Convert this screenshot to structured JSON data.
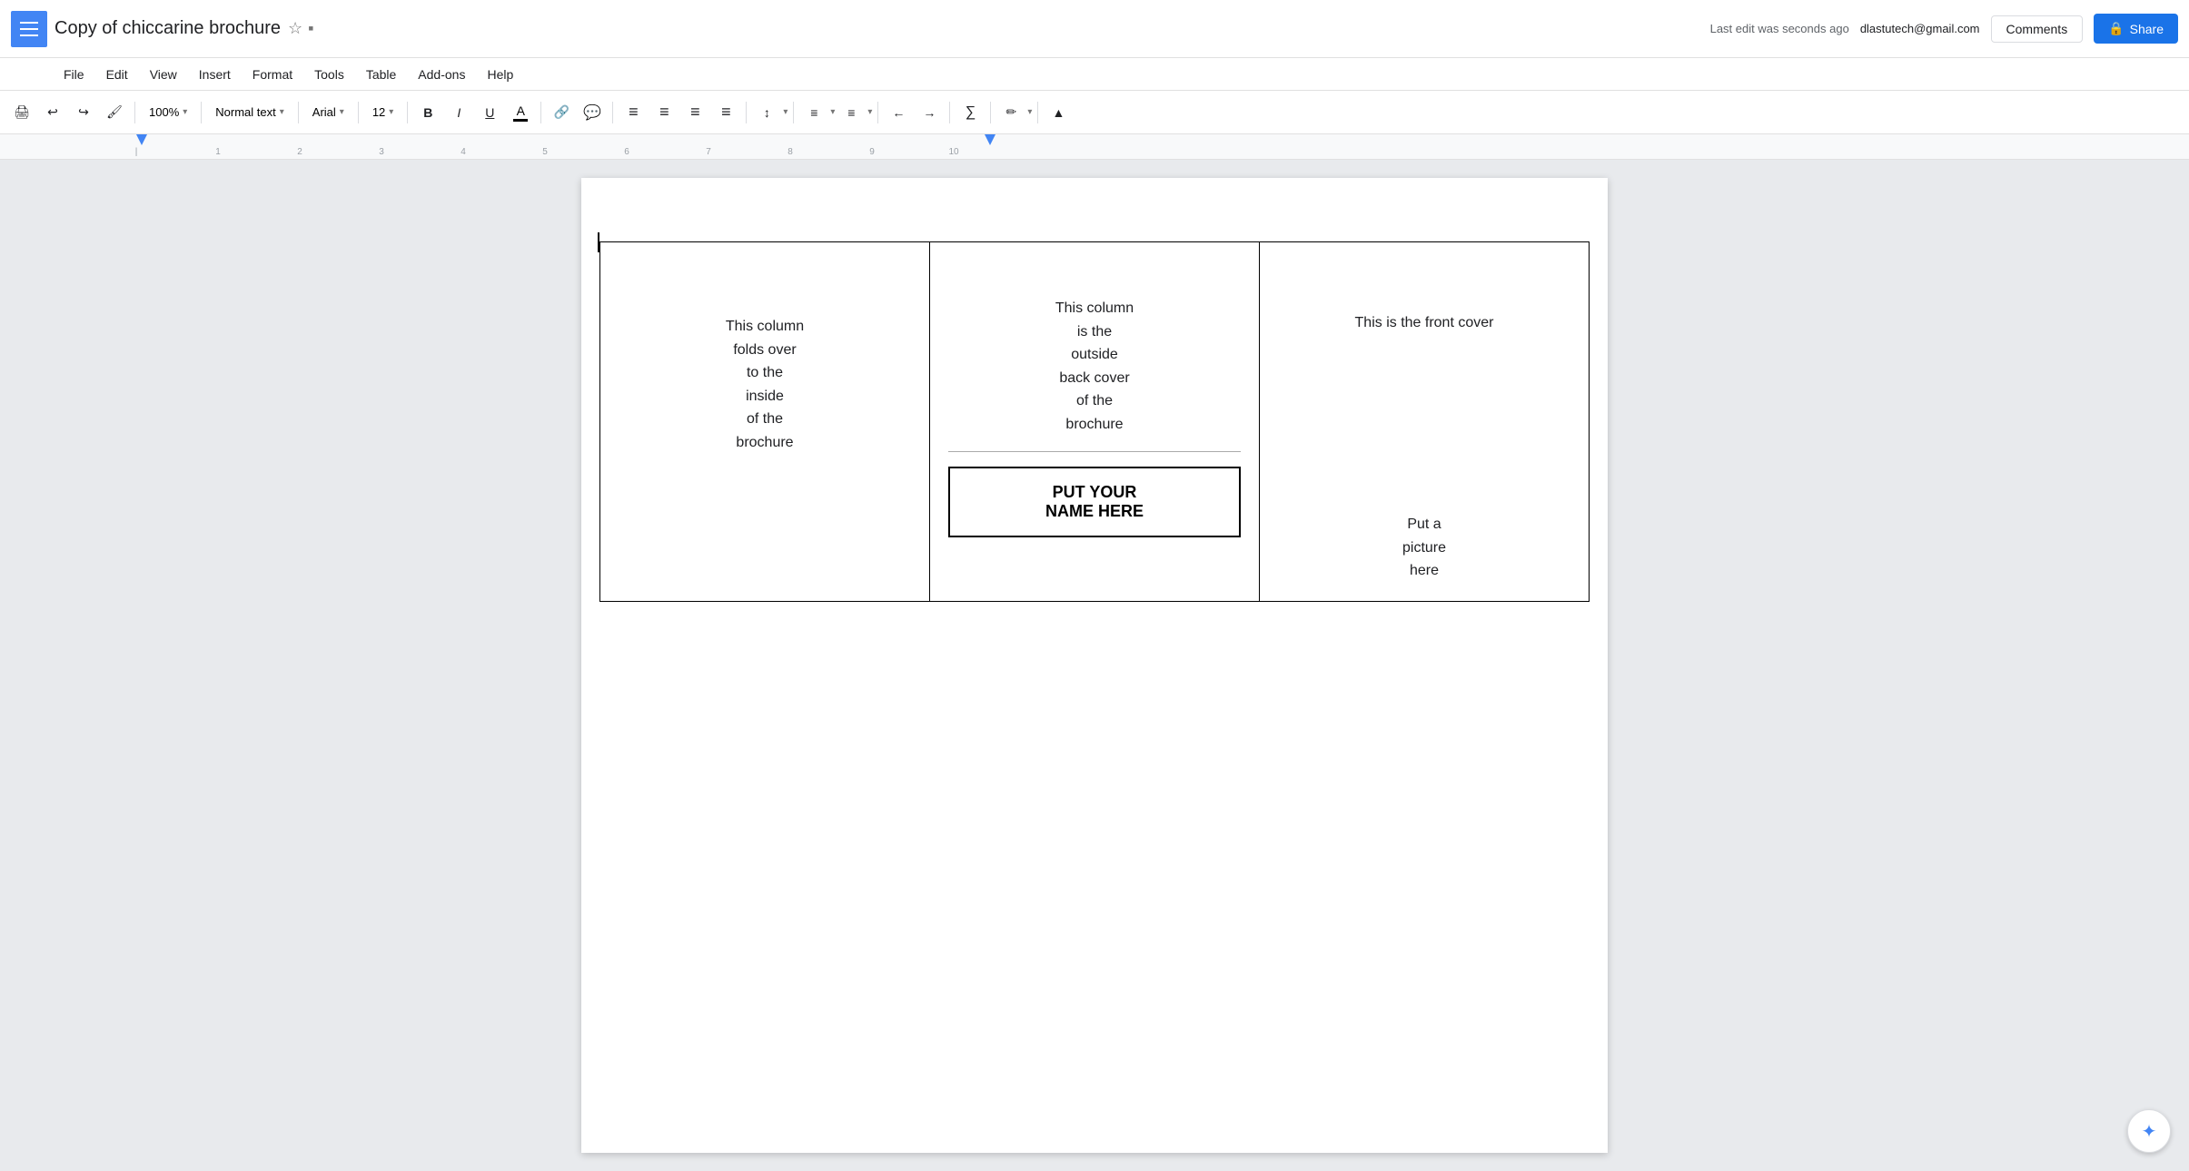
{
  "app": {
    "menu_icon": "≡",
    "doc_title": "Copy of chiccarine brochure",
    "star_icon": "☆",
    "folder_icon": "▪"
  },
  "top_right": {
    "user_email": "dlastutech@gmail.com",
    "last_edit": "Last edit was seconds ago",
    "comments_label": "Comments",
    "share_label": "Share",
    "share_icon": "🔒"
  },
  "menu": {
    "items": [
      "File",
      "Insert",
      "View",
      "Insert",
      "Format",
      "Tools",
      "Table",
      "Add-ons",
      "Help"
    ]
  },
  "toolbar": {
    "print_icon": "🖨",
    "undo_icon": "↩",
    "redo_icon": "↪",
    "paint_format_icon": "🖌",
    "zoom_value": "100%",
    "zoom_arrow": "▾",
    "style_value": "Normal text",
    "style_arrow": "▾",
    "font_value": "Arial",
    "font_arrow": "▾",
    "font_size_value": "12",
    "font_size_arrow": "▾",
    "bold_label": "B",
    "italic_label": "I",
    "underline_label": "U",
    "font_color_label": "A",
    "link_icon": "🔗",
    "comment_icon": "💬",
    "align_left": "≡",
    "align_center": "≡",
    "align_right": "≡",
    "align_justify": "≡",
    "line_spacing_icon": "↕",
    "numbered_list_icon": "≡",
    "bullet_list_icon": "≡",
    "indent_less_icon": "←",
    "indent_more_icon": "→",
    "formula_icon": "∑",
    "pen_icon": "✏",
    "collapse_icon": "▲"
  },
  "document": {
    "col1_text": "This column\nfolds over\nto the\ninside\nof the\nbrochure",
    "col2_top_text": "This column\nis the\noutside\nback cover\nof the\nbrochure",
    "col2_name_text": "PUT YOUR\nNAME HERE",
    "col3_title": "This is the front cover",
    "col3_picture": "Put a\npicture\nhere"
  }
}
